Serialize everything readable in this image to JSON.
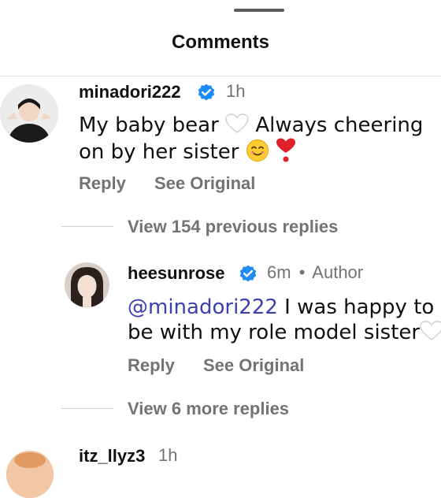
{
  "sheet": {
    "title": "Comments"
  },
  "comments": [
    {
      "username": "minadori222",
      "time": "1h",
      "text_before": "My baby bear",
      "text_middle": " Always cheering",
      "text_line2": "on by her sister",
      "actions": {
        "reply": "Reply",
        "see_original": "See Original"
      }
    },
    {
      "username": "itz_llyz3",
      "time": "1h"
    }
  ],
  "thread": {
    "view_previous": "View 154 previous replies",
    "view_more": "View 6 more replies",
    "reply": {
      "username": "heesunrose",
      "time": "6m",
      "separator": "•",
      "badge": "Author",
      "mention": "@minadori222",
      "text_line1": " I was happy to",
      "text_line2": "be with my role model sister",
      "actions": {
        "reply": "Reply",
        "see_original": "See Original"
      }
    }
  },
  "icons": {
    "verified": "verified-badge-icon",
    "white_heart": "white-heart-emoji",
    "smile": "smiling-face-emoji",
    "red_heart": "heart-exclamation-emoji"
  },
  "colors": {
    "verified": "#1d8cf5",
    "mention": "#3b3fb0",
    "muted": "#737373"
  }
}
